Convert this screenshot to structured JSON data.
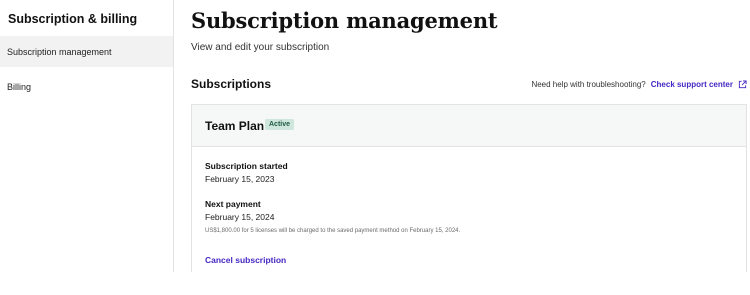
{
  "sidebar": {
    "title": "Subscription & billing",
    "items": [
      {
        "label": "Subscription management",
        "active": true
      },
      {
        "label": "Billing",
        "active": false
      }
    ]
  },
  "header": {
    "title": "Subscription management",
    "subtitle": "View and edit your subscription"
  },
  "subscriptions": {
    "title": "Subscriptions",
    "help_text": "Need help with troubleshooting?",
    "help_link": "Check support center",
    "help_link_icon": "external-link-icon"
  },
  "plan": {
    "name": "Team Plan",
    "status": "Active",
    "started_label": "Subscription started",
    "started_date": "February 15, 2023",
    "next_payment_label": "Next payment",
    "next_payment_date": "February 15, 2024",
    "note": "US$1,800.00 for 5 licenses will be charged to the saved payment method on February 15, 2024.",
    "cancel_label": "Cancel subscription"
  },
  "colors": {
    "link": "#4527c4",
    "badge_bg": "#cfe6dd",
    "badge_text": "#1e5a45",
    "sidebar_active_bg": "#f2f2f2"
  }
}
